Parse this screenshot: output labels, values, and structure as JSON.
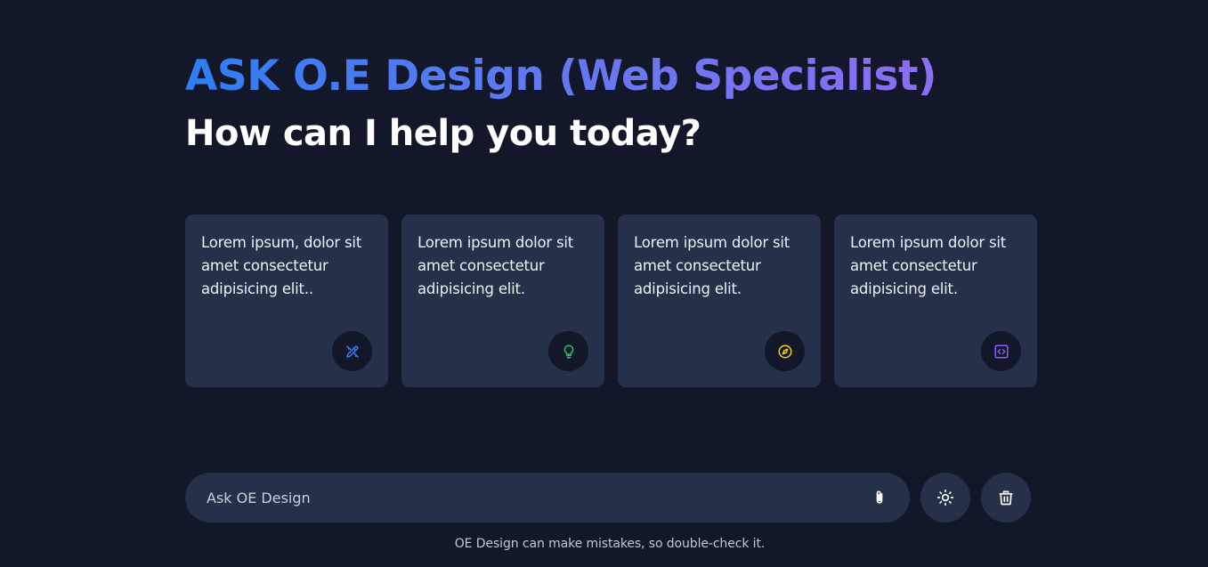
{
  "header": {
    "title": "ASK O.E Design (Web Specialist)",
    "subtitle": "How can I help you today?"
  },
  "cards": [
    {
      "text": "Lorem ipsum, dolor sit amet consectetur adipisicing elit..",
      "icon": "pencil-ruler-icon",
      "icon_color": "#3b82f6"
    },
    {
      "text": "Lorem ipsum dolor sit amet consectetur adipisicing elit.",
      "icon": "lightbulb-icon",
      "icon_color": "#22c55e"
    },
    {
      "text": "Lorem ipsum dolor sit amet consectetur adipisicing elit.",
      "icon": "compass-icon",
      "icon_color": "#facc15"
    },
    {
      "text": "Lorem ipsum dolor sit amet consectetur adipisicing elit.",
      "icon": "code-icon",
      "icon_color": "#8b5cf6"
    }
  ],
  "input": {
    "placeholder": "Ask OE Design",
    "value": ""
  },
  "buttons": {
    "attach": "paperclip-icon",
    "theme": "sun-icon",
    "delete": "trash-icon"
  },
  "footer": {
    "disclaimer": "OE Design can make mistakes, so double-check it."
  },
  "colors": {
    "background": "#121729",
    "surface": "#263048",
    "title_gradient_start": "#2f7df4",
    "title_gradient_end": "#8c6ef2"
  }
}
